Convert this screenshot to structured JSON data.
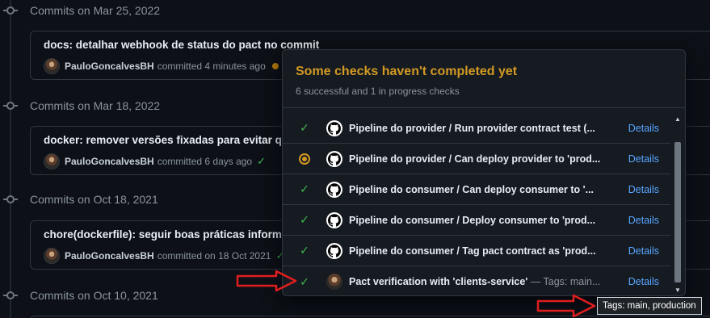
{
  "timeline": [
    {
      "date": "Commits on Mar 25, 2022",
      "commit": {
        "title": "docs: detalhar webhook de status do pact no commit",
        "author": "PauloGoncalvesBH",
        "meta": "committed 4 minutes ago",
        "status": "pending"
      }
    },
    {
      "date": "Commits on Mar 18, 2022",
      "commit": {
        "title": "docker: remover versões fixadas para evitar qu",
        "author": "PauloGoncalvesBH",
        "meta": "committed 6 days ago",
        "status": "success"
      }
    },
    {
      "date": "Commits on Oct 18, 2021",
      "commit": {
        "title": "chore(dockerfile): seguir boas práticas informa",
        "author": "PauloGoncalvesBH",
        "meta": "committed on 18 Oct 2021",
        "status": "success"
      }
    },
    {
      "date": "Commits on Oct 10, 2021"
    }
  ],
  "popover": {
    "title": "Some checks haven't completed yet",
    "subtitle": "6 successful and 1 in progress checks",
    "checks": [
      {
        "name": "Pipeline do provider / Run provider contract test (...",
        "state": "success",
        "app": "github-icon",
        "action": "Details"
      },
      {
        "name": "Pipeline do provider / Can deploy provider to 'prod...",
        "state": "pending",
        "app": "github-icon",
        "action": "Details"
      },
      {
        "name": "Pipeline do consumer / Can deploy consumer to '...",
        "state": "success",
        "app": "github-icon",
        "action": "Details"
      },
      {
        "name": "Pipeline do consumer / Deploy consumer to 'prod...",
        "state": "success",
        "app": "github-icon",
        "action": "Details"
      },
      {
        "name": "Pipeline do consumer / Tag pact contract as 'prod...",
        "state": "success",
        "app": "github-icon",
        "action": "Details"
      },
      {
        "name": "Pact verification with 'clients-service'",
        "tags": " — Tags: main...",
        "state": "success",
        "app": "user-avatar",
        "action": "Details"
      }
    ]
  },
  "tooltip": {
    "text": "Tags: main, production"
  },
  "colors": {
    "warning": "#d29922",
    "success": "#3fb950",
    "link": "#58a6ff",
    "annotation_arrow": "#e01e1e"
  }
}
